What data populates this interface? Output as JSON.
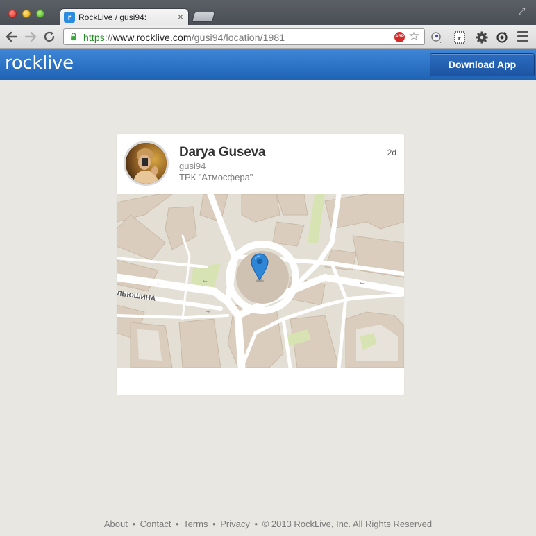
{
  "browser": {
    "tab_title": "RockLive / gusi94:",
    "tab_close": "×",
    "url_scheme": "https",
    "url_sep": "://",
    "url_host": "www.rocklive.com",
    "url_path": "/gusi94/location/1981",
    "abp_label": "ABP",
    "favicon_letter": "r"
  },
  "site": {
    "logo": "rocklive",
    "download_label": "Download App",
    "brand_color": "#2a6fc4"
  },
  "post": {
    "name": "Darya Guseva",
    "username": "gusi94",
    "location": "ТРК \"Атмосфера\"",
    "time": "2d"
  },
  "map": {
    "street_label": "ЛЬЮШИНА",
    "pin_color": "#2f86d6"
  },
  "footer": {
    "links": [
      "About",
      "Contact",
      "Terms",
      "Privacy"
    ],
    "separator": "•",
    "copyright": "© 2013 RockLive, Inc. All Rights Reserved"
  }
}
